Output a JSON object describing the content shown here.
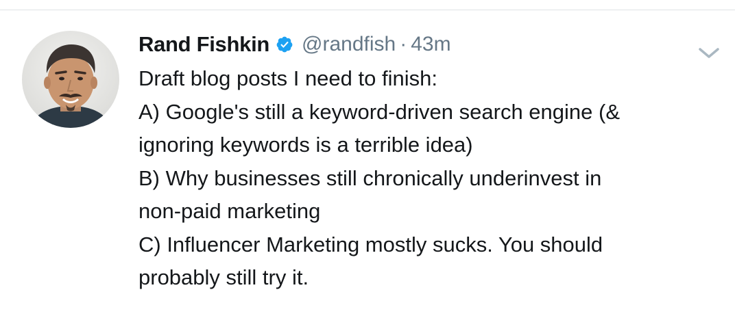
{
  "tweet": {
    "author": {
      "display_name": "Rand Fishkin",
      "handle": "@randfish",
      "verified": true
    },
    "separator": "·",
    "time_ago": "43m",
    "lines": [
      "Draft blog posts I need to finish:",
      "A) Google's still a keyword-driven search engine (&",
      "ignoring keywords is a terrible idea)",
      "B) Why businesses still chronically underinvest in",
      "non-paid marketing",
      "C) Influencer Marketing mostly sucks. You should",
      "probably still try it."
    ]
  },
  "icons": {
    "verified": "verified-badge-icon",
    "menu": "chevron-down-icon"
  },
  "colors": {
    "text_primary": "#14171a",
    "text_secondary": "#657786",
    "verified_blue": "#1da1f2",
    "divider": "#dfe3e6"
  }
}
